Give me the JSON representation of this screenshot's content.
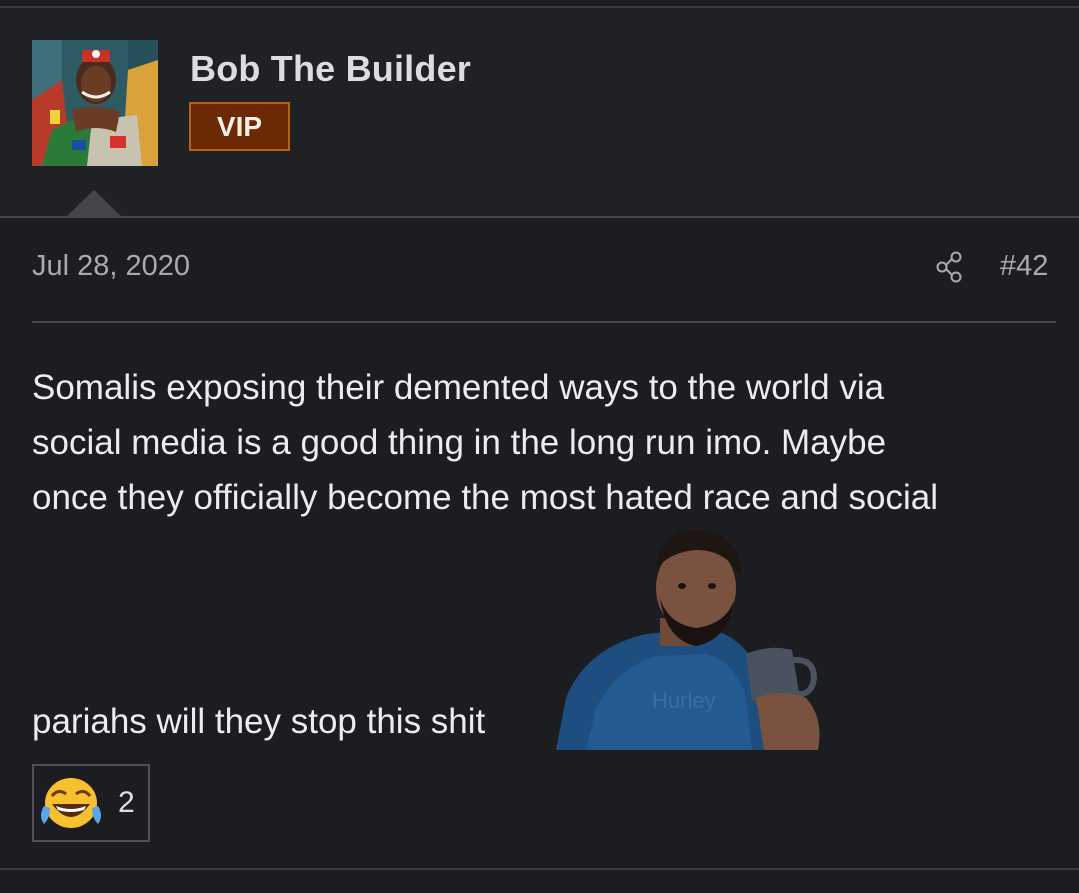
{
  "post": {
    "author": {
      "name": "Bob The Builder",
      "badge": "VIP"
    },
    "date": "Jul 28, 2020",
    "number": "#42",
    "body_lines": [
      "Somalis exposing their demented ways to the world via",
      "social media is a good thing in the long run imo. Maybe",
      "once they officially become the most hated race and social"
    ],
    "last_line": "pariahs will they stop this shit",
    "reaction": {
      "emoji": "face-with-tears-of-joy-icon",
      "count": "2"
    }
  },
  "colors": {
    "background": "#1c1d20",
    "header_bg": "#202125",
    "badge_bg": "#6b2a04",
    "badge_border": "#b4630f",
    "muted_text": "#a9aab0",
    "divider": "#45464b"
  }
}
